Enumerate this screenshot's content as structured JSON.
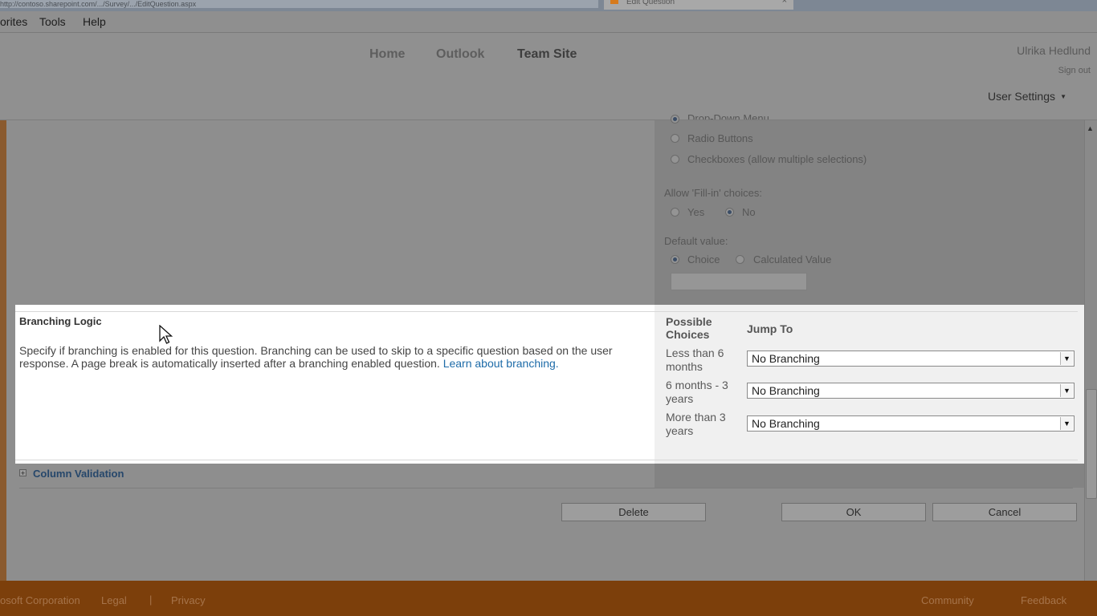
{
  "browser": {
    "url_text": "http://contoso.sharepoint.com/.../Survey/.../EditQuestion.aspx",
    "tab_title": "Edit Question"
  },
  "menubar": {
    "items": [
      "orites",
      "Tools",
      "Help"
    ]
  },
  "header": {
    "nav": [
      "Home",
      "Outlook",
      "Team Site"
    ],
    "user_name": "Ulrika Hedlund",
    "sign_out": "Sign out",
    "user_settings": "User Settings"
  },
  "display_options": {
    "partial_top": "Drop-Down Menu",
    "radio_buttons": "Radio Buttons",
    "checkboxes": "Checkboxes (allow multiple selections)"
  },
  "fill_in": {
    "label": "Allow 'Fill-in' choices:",
    "yes": "Yes",
    "no": "No"
  },
  "default_value": {
    "label": "Default value:",
    "choice": "Choice",
    "calculated": "Calculated Value"
  },
  "branching": {
    "title": "Branching Logic",
    "description": "Specify if branching is enabled for this question. Branching can be used to skip to a specific question based on the user response. A page break is automatically inserted after a branching enabled question.",
    "learn_link": "Learn about branching.",
    "col_choices": "Possible Choices",
    "col_jump": "Jump To",
    "rows": [
      {
        "choice": "Less than 6 months",
        "jump": "No Branching"
      },
      {
        "choice": "6 months - 3 years",
        "jump": "No Branching"
      },
      {
        "choice": "More than 3 years",
        "jump": "No Branching"
      }
    ]
  },
  "column_validation": {
    "label": "Column Validation",
    "expand_symbol": "+"
  },
  "buttons": {
    "delete": "Delete",
    "ok": "OK",
    "cancel": "Cancel"
  },
  "footer": {
    "copyright": "osoft Corporation",
    "legal": "Legal",
    "separator": "|",
    "privacy": "Privacy",
    "community": "Community",
    "feedback": "Feedback"
  },
  "colors": {
    "footer_bg": "#7c3f0b",
    "link_blue": "#1d6ba8",
    "highlight_bg": "#ffffff"
  }
}
